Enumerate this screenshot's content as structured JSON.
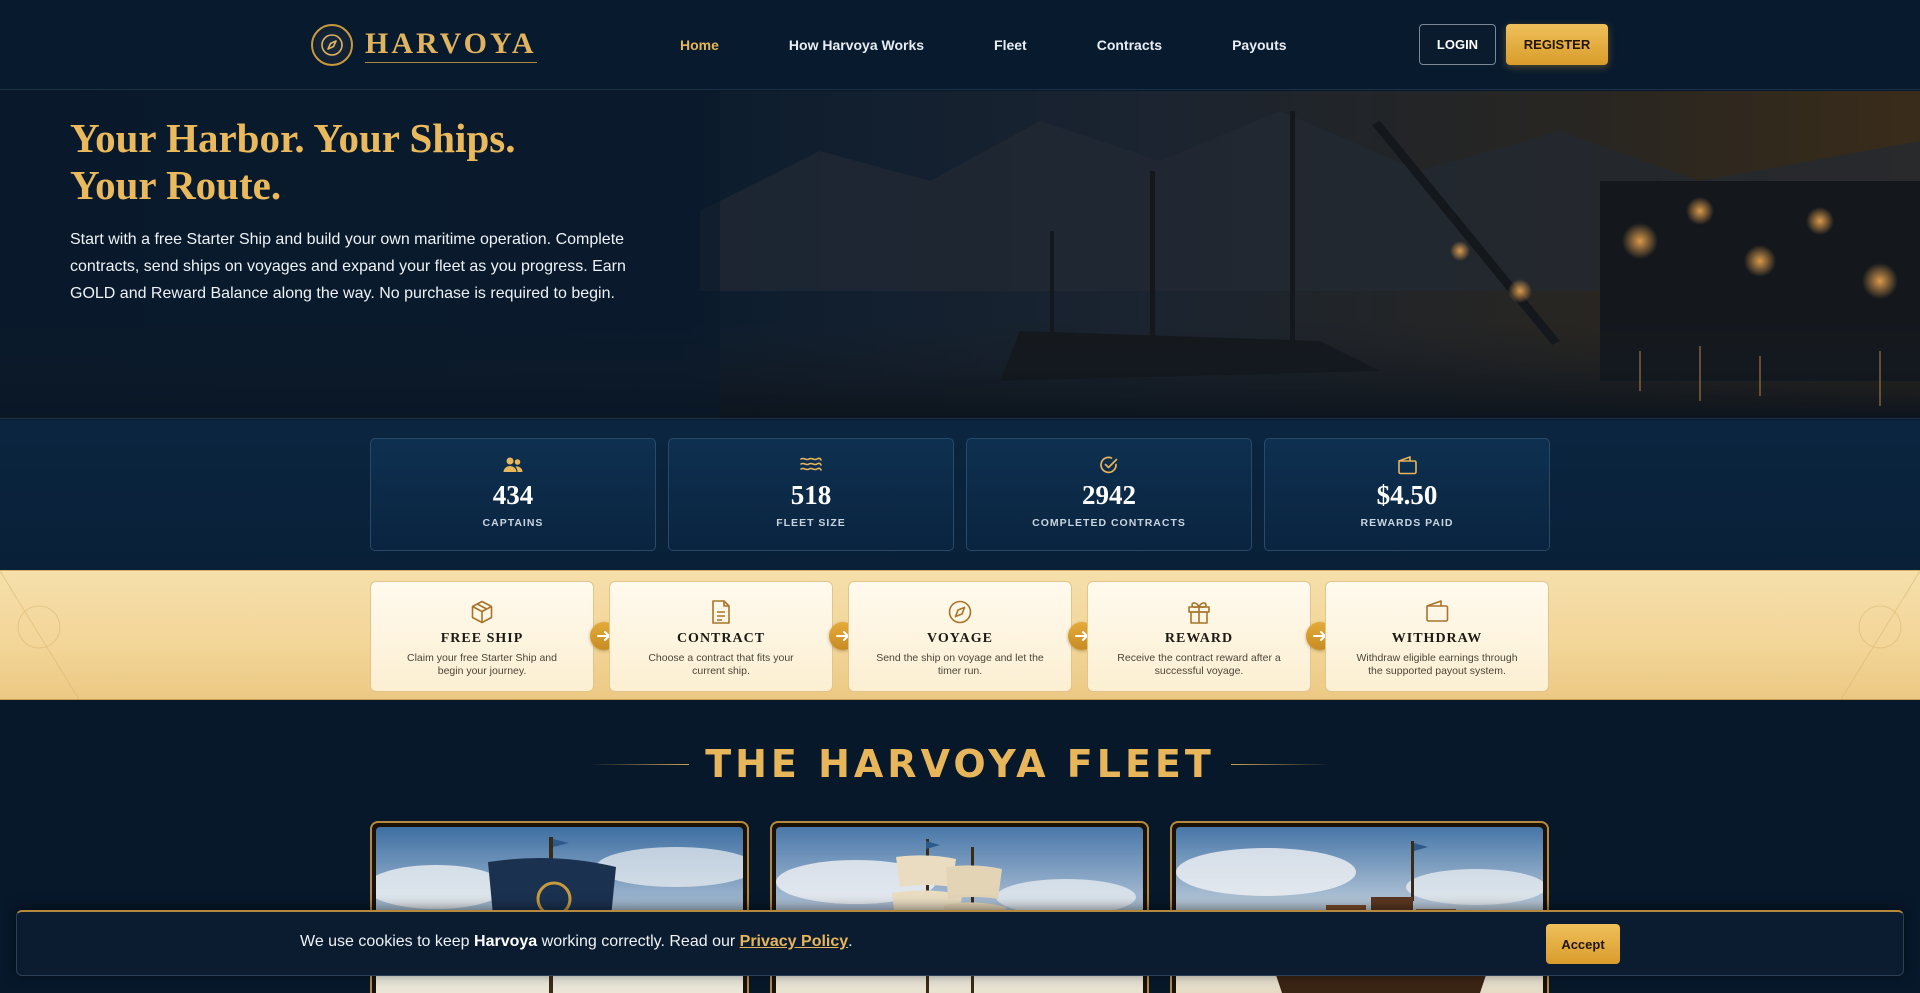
{
  "header": {
    "logo_text": "HARVOYA",
    "nav": [
      {
        "label": "Home",
        "active": true
      },
      {
        "label": "How Harvoya Works"
      },
      {
        "label": "Fleet"
      },
      {
        "label": "Contracts"
      },
      {
        "label": "Payouts"
      }
    ],
    "login_label": "LOGIN",
    "register_label": "REGISTER"
  },
  "hero": {
    "title_line1": "Your Harbor. Your Ships.",
    "title_line2": "Your Route.",
    "text": "Start with a free Starter Ship and build your own maritime operation. Complete contracts, send ships on voyages and expand your fleet as you progress. Earn GOLD and Reward Balance along the way. No purchase is required to begin."
  },
  "stats": [
    {
      "icon": "captains-icon",
      "value": "434",
      "label": "CAPTAINS"
    },
    {
      "icon": "waves-icon",
      "value": "518",
      "label": "FLEET SIZE"
    },
    {
      "icon": "check-circle-icon",
      "value": "2942",
      "label": "COMPLETED CONTRACTS"
    },
    {
      "icon": "wallet-icon",
      "value": "$4.50",
      "label": "REWARDS PAID"
    }
  ],
  "steps": [
    {
      "icon": "box-icon",
      "title": "FREE SHIP",
      "desc": "Claim your free Starter Ship and begin your journey."
    },
    {
      "icon": "document-icon",
      "title": "CONTRACT",
      "desc": "Choose a contract that fits your current ship."
    },
    {
      "icon": "compass-icon",
      "title": "VOYAGE",
      "desc": "Send the ship on voyage and let the timer run."
    },
    {
      "icon": "gift-icon",
      "title": "REWARD",
      "desc": "Receive the contract reward after a successful voyage."
    },
    {
      "icon": "wallet-icon",
      "title": "WITHDRAW",
      "desc": "Withdraw eligible earnings through the supported payout system."
    }
  ],
  "fleet": {
    "title": "THE HARVOYA FLEET"
  },
  "cookie": {
    "text_before": "We use cookies to keep ",
    "brand": "Harvoya",
    "text_middle": " working correctly. Read our ",
    "link": "Privacy Policy",
    "text_after": ".",
    "accept_label": "Accept"
  },
  "colors": {
    "accent_gold": "#e7b55a",
    "navy_bg": "#07182b",
    "cream_band": "#f3d699"
  }
}
